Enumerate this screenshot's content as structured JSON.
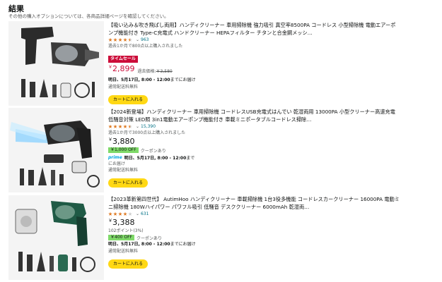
{
  "header": {
    "title": "結果",
    "subtitle": "その他の購入オプションについては、各商品詳細ページを確認してください。"
  },
  "items": [
    {
      "title": "【吸い込み＆吹き飛ばし両用】ハンディクリーナー 車用掃除機 強力吸引 真空率8500PA コードレス 小型掃除機 電動エアーポンプ機能付き Type-C充電式 ハンドクリーナー HEPAフィルター チタンと合金鋼メッシ…",
      "rating": 4.5,
      "review_count": "963",
      "sold": "過去1か月で800点以上購入されました",
      "badge": "タイムセール",
      "price_symbol": "￥",
      "price": "2,899",
      "ref_label": "過去価格:",
      "ref_price": "￥3,580",
      "delivery_prefix": "明日、",
      "delivery_date": "5月17日, 8:00 - 12:00",
      "delivery_suffix": "までにお届け",
      "shipping": "通常配送料無料",
      "cart_label": "カートに入れる"
    },
    {
      "title": "【2024新登場】ハンディクリーナー 車用掃除機 コードレスUSB充電式はんでい 乾湿両用 13000PA 小型クリーナー高速充電 低騒音対策 LED照 3in1電動エアーポンプ機能付き 車載ミニポータブルコードレス掃除…",
      "rating": 4.5,
      "review_count": "15,390",
      "sold": "過去1か月で3000点以上購入されました",
      "price_symbol": "￥",
      "price": "3,880",
      "coupon": "￥1,000 OFF",
      "coupon_suffix": "クーポンあり",
      "prime_label": "prime",
      "delivery_prefix": "明日、",
      "delivery_date": "5月17日, 8:00 - 12:00",
      "delivery_suffix": "まで",
      "delivery_line2": "にお届け",
      "shipping": "通常配送料無料",
      "cart_label": "カートに入れる"
    },
    {
      "title": "【2023革新第四世代】 AutimHoo ハンディクリーナー 車載掃除機 1台3役多機能 コードレスカークリーナー 16000PA 電動ミニ掃除機 180Wハイパワー パワフル吸引 低騒音 デスククリーナー 6000mAh 乾湿両…",
      "rating": 4.0,
      "review_count": "631",
      "price_symbol": "￥",
      "price": "3,388",
      "points": "102ポイント(3%)",
      "coupon": "￥400 OFF",
      "coupon_suffix": "クーポンあり",
      "delivery_prefix": "明日、",
      "delivery_date": "5月17日, 8:00 - 12:00",
      "delivery_suffix": "までにお届け",
      "shipping": "通常配送料無料",
      "cart_label": "カートに入れる"
    }
  ],
  "colors": {
    "price_red": "#cc0c39",
    "star_orange": "#de7921",
    "cart_yellow": "#ffd814",
    "coupon_green": "#7fda69",
    "prime_blue": "#00a8e1"
  }
}
